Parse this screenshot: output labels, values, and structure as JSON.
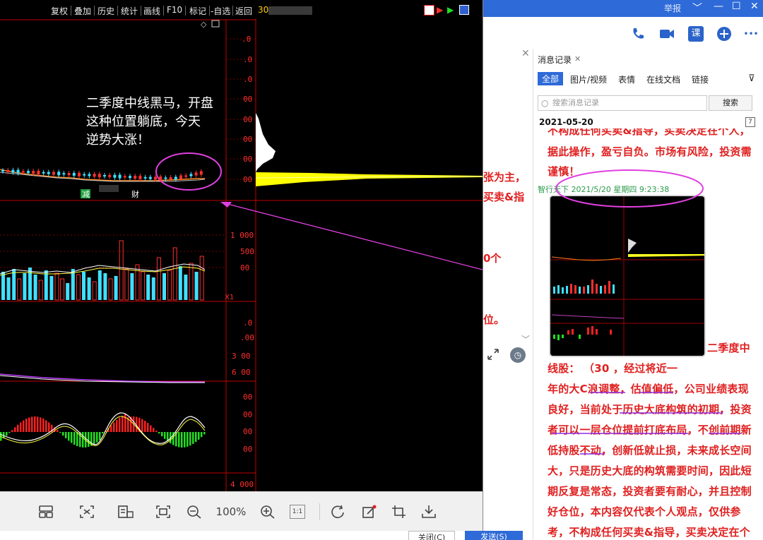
{
  "stock_window": {
    "menu": [
      "复权",
      "叠加",
      "历史",
      "统计",
      "画线",
      "F10",
      "标记",
      "-自选",
      "返回"
    ],
    "menu_code": "30",
    "annotation": [
      "二季度中线黑马，开盘",
      "这种位置躺底，今天",
      "逆势大涨！"
    ],
    "tag_reduce": "减",
    "tag_finance": "财",
    "price_axis": [
      ".0",
      ".0",
      ".0",
      "00",
      "00",
      "00",
      "00",
      "00"
    ],
    "vol_axis": [
      "1 000",
      "500",
      "00"
    ],
    "vol_tag": "X1",
    "ind_axis1": [
      ".0",
      ".00",
      "3 00",
      "6 00"
    ],
    "ind_axis2": [
      "00",
      "00",
      "00",
      "00"
    ],
    "bottom_axis": "4 000"
  },
  "viewer_bar": {
    "zoom_label": "100%",
    "icons": [
      "layout-icon",
      "fit-icon",
      "ocr-icon",
      "crop-frame-icon",
      "zoom-out-icon",
      "zoom-in-icon",
      "actual-size-icon",
      "rotate-icon",
      "annotate-icon",
      "crop-icon",
      "download-icon"
    ],
    "actual_size_label": "1:1"
  },
  "chat": {
    "title_report": "举报",
    "window_controls": [
      "﹀",
      "—",
      "☐",
      "✕"
    ],
    "toolbar_icons": [
      "phone-icon",
      "video-icon",
      "course-icon",
      "add-icon",
      "more-icon"
    ],
    "course_label": "课",
    "more_label": "•••",
    "body_fragments": [
      "张为主，",
      "买卖&指",
      "0个",
      "位。"
    ],
    "close_btn": "关闭(C)",
    "send_btn": "发送(S)"
  },
  "history": {
    "tab_title": "消息记录",
    "filters": [
      "全部",
      "图片/视频",
      "表情",
      "在线文档",
      "链接"
    ],
    "search_placeholder": "搜索消息记录",
    "search_btn": "搜索",
    "date": "2021-05-20",
    "calendar_day": "7",
    "prev_lines": [
      "不构成任何买卖&指导，买卖决定在个人，",
      "据此操作，盈亏自负。市场有风险，投资需",
      "谨慎！"
    ],
    "meta": "智行天下 2021/5/20 星期四 9:23:38",
    "msg_lines": [
      "二季度中",
      "线股：                     （30              ，经过将近一",
      "年的大C浪调整，估值偏低，公司业绩表现",
      "良好，当前处于历史大底构筑的初期，投资",
      "者可以一层仓位提前打底布局，不创前期新",
      "低持股不动，创新低就止损，未来成长空间",
      "大，只是历史大底的构筑需要时间，因此短",
      "期反复是常态，投资者要有耐心，并且控制",
      "好仓位，本内容仅代表个人观点，仅供参",
      "考，不构成任何买卖&指导，买卖决定在个"
    ]
  },
  "colors": {
    "candle_up": "#ff3030",
    "candle_down": "#40e0ff",
    "macd_up": "#ff2020",
    "macd_down": "#20e020",
    "highlight_ellipse": "#e040e0",
    "volume_profile": "#ffff00",
    "chat_accent": "#2e6ad8",
    "message_red": "#e02020"
  }
}
